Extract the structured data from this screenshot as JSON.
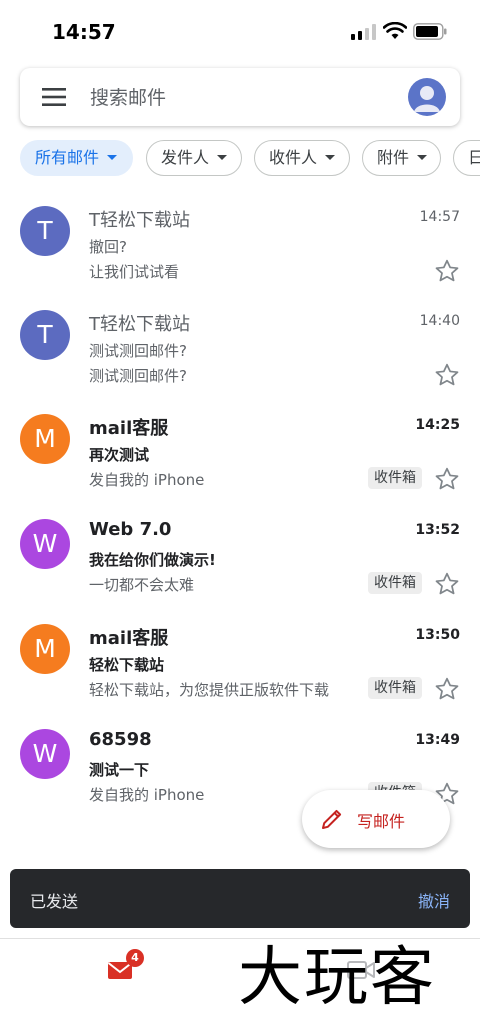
{
  "status_bar": {
    "time": "14:57"
  },
  "search": {
    "placeholder": "搜索邮件"
  },
  "filters": [
    {
      "label": "所有邮件",
      "active": true
    },
    {
      "label": "发件人",
      "active": false
    },
    {
      "label": "收件人",
      "active": false
    },
    {
      "label": "附件",
      "active": false
    },
    {
      "label": "日",
      "active": false
    }
  ],
  "emails": [
    {
      "avatar_letter": "T",
      "avatar_color": "#5c6bc0",
      "sender": "T轻松下载站",
      "time": "14:57",
      "subject": "撤回?",
      "snippet": "让我们试试看",
      "label": "",
      "unread": false
    },
    {
      "avatar_letter": "T",
      "avatar_color": "#5c6bc0",
      "sender": "T轻松下载站",
      "time": "14:40",
      "subject": "测试测回邮件?",
      "snippet": "测试测回邮件?",
      "label": "",
      "unread": false
    },
    {
      "avatar_letter": "M",
      "avatar_color": "#f57c1f",
      "sender": "mail客服",
      "time": "14:25",
      "subject": "再次测试",
      "snippet": "发自我的 iPhone",
      "label": "收件箱",
      "unread": true
    },
    {
      "avatar_letter": "W",
      "avatar_color": "#ab47e0",
      "sender": "Web 7.0",
      "time": "13:52",
      "subject": "我在给你们做演示!",
      "snippet": "一切都不会太难",
      "label": "收件箱",
      "unread": true
    },
    {
      "avatar_letter": "M",
      "avatar_color": "#f57c1f",
      "sender": "mail客服",
      "time": "13:50",
      "subject": "轻松下载站",
      "snippet": "轻松下载站，为您提供正版软件下载",
      "label": "收件箱",
      "unread": true
    },
    {
      "avatar_letter": "W",
      "avatar_color": "#ab47e0",
      "sender": "68598",
      "time": "13:49",
      "subject": "测试一下",
      "snippet": "发自我的 iPhone",
      "label": "收件箱",
      "unread": true
    }
  ],
  "compose": {
    "label": "写邮件"
  },
  "snackbar": {
    "message": "已发送",
    "action": "撤消"
  },
  "bottom_nav": {
    "mail_badge": "4"
  },
  "watermark": {
    "text": "大玩客"
  },
  "colors": {
    "accent_blue": "#1a73e8",
    "compose_red": "#c5221f",
    "snackbar_bg": "#26282b",
    "snackbar_action": "#8ab4f8"
  }
}
